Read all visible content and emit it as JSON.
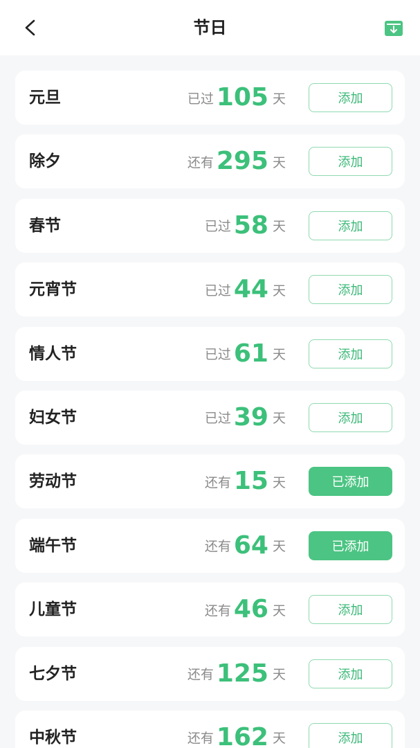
{
  "header": {
    "title": "节日",
    "back_icon": "chevron-left-icon",
    "action_icon": "download-box-icon"
  },
  "colors": {
    "accent": "#3cc07a",
    "added_bg": "#4cc483",
    "muted": "#8a8a8a"
  },
  "festivals": [
    {
      "name": "元旦",
      "status": "已过",
      "days": "105",
      "unit": "天",
      "button": "添加",
      "added": false
    },
    {
      "name": "除夕",
      "status": "还有",
      "days": "295",
      "unit": "天",
      "button": "添加",
      "added": false
    },
    {
      "name": "春节",
      "status": "已过",
      "days": "58",
      "unit": "天",
      "button": "添加",
      "added": false
    },
    {
      "name": "元宵节",
      "status": "已过",
      "days": "44",
      "unit": "天",
      "button": "添加",
      "added": false
    },
    {
      "name": "情人节",
      "status": "已过",
      "days": "61",
      "unit": "天",
      "button": "添加",
      "added": false
    },
    {
      "name": "妇女节",
      "status": "已过",
      "days": "39",
      "unit": "天",
      "button": "添加",
      "added": false
    },
    {
      "name": "劳动节",
      "status": "还有",
      "days": "15",
      "unit": "天",
      "button": "已添加",
      "added": true
    },
    {
      "name": "端午节",
      "status": "还有",
      "days": "64",
      "unit": "天",
      "button": "已添加",
      "added": true
    },
    {
      "name": "儿童节",
      "status": "还有",
      "days": "46",
      "unit": "天",
      "button": "添加",
      "added": false
    },
    {
      "name": "七夕节",
      "status": "还有",
      "days": "125",
      "unit": "天",
      "button": "添加",
      "added": false
    },
    {
      "name": "中秋节",
      "status": "还有",
      "days": "162",
      "unit": "天",
      "button": "添加",
      "added": false
    }
  ]
}
